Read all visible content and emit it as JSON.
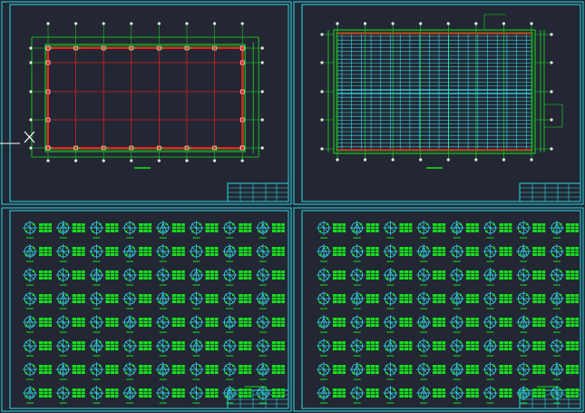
{
  "colors": {
    "background": "#222733",
    "frame": "#29d9e4",
    "grid_red": "#d42020",
    "beam_red": "#ff1a1a",
    "green": "#19e01e",
    "cyan": "#36e3ef",
    "node": "#e8e8e8",
    "cross": "#ffffff"
  },
  "sheets": [
    {
      "id": "sheet-1",
      "kind": "column-grid-plan"
    },
    {
      "id": "sheet-2",
      "kind": "purlin-layout-plan"
    },
    {
      "id": "sheet-3",
      "kind": "connection-details",
      "rows": 8,
      "cols": 8
    },
    {
      "id": "sheet-4",
      "kind": "connection-details",
      "rows": 8,
      "cols": 8
    }
  ]
}
